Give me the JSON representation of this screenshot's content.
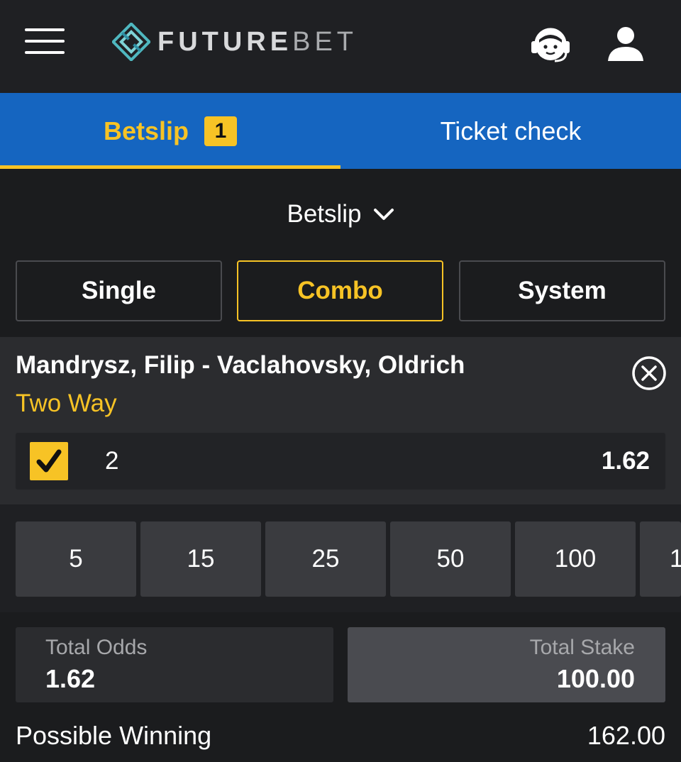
{
  "header": {
    "logo_text_primary": "FUTURE",
    "logo_text_secondary": "BET",
    "menu_icon": "hamburger-menu-icon",
    "support_icon": "customer-support-icon",
    "user_icon": "user-account-icon"
  },
  "tabs": [
    {
      "label": "Betslip",
      "badge": "1",
      "active": true
    },
    {
      "label": "Ticket check",
      "active": false
    }
  ],
  "dropdown": {
    "label": "Betslip",
    "icon": "chevron-down-icon"
  },
  "bet_types": [
    {
      "label": "Single",
      "active": false
    },
    {
      "label": "Combo",
      "active": true
    },
    {
      "label": "System",
      "active": false
    }
  ],
  "selection": {
    "match": "Mandrysz, Filip - Vaclahovsky, Oldrich",
    "market": "Two Way",
    "outcome": "2",
    "odds": "1.62",
    "checked": true,
    "remove_icon": "close-circle-icon"
  },
  "quick_stakes": [
    "5",
    "15",
    "25",
    "50",
    "100",
    "1"
  ],
  "totals": {
    "odds_label": "Total Odds",
    "odds_value": "1.62",
    "stake_label": "Total Stake",
    "stake_value": "100.00",
    "winning_label": "Possible Winning",
    "winning_value": "162.00"
  },
  "colors": {
    "accent": "#f7c325",
    "tab_bar": "#1565c0",
    "background": "#1b1c1e"
  }
}
